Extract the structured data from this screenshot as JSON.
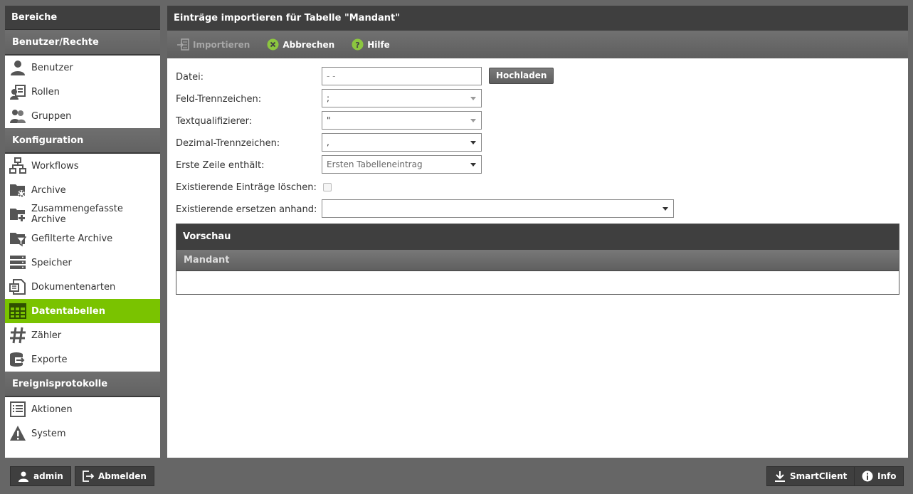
{
  "sidebar": {
    "title": "Bereiche",
    "sections": [
      {
        "label": "Benutzer/Rechte",
        "items": [
          {
            "label": "Benutzer",
            "icon": "user-icon"
          },
          {
            "label": "Rollen",
            "icon": "roles-icon"
          },
          {
            "label": "Gruppen",
            "icon": "group-icon"
          }
        ]
      },
      {
        "label": "Konfiguration",
        "items": [
          {
            "label": "Workflows",
            "icon": "workflow-icon"
          },
          {
            "label": "Archive",
            "icon": "archive-folder-icon"
          },
          {
            "label": "Zusammengefasste Archive",
            "icon": "combined-archive-icon"
          },
          {
            "label": "Gefilterte Archive",
            "icon": "filtered-archive-icon"
          },
          {
            "label": "Speicher",
            "icon": "storage-icon"
          },
          {
            "label": "Dokumentenarten",
            "icon": "document-types-icon"
          },
          {
            "label": "Datentabellen",
            "icon": "data-table-icon",
            "active": true
          },
          {
            "label": "Zähler",
            "icon": "hash-icon"
          },
          {
            "label": "Exporte",
            "icon": "export-icon"
          }
        ]
      },
      {
        "label": "Ereignisprotokolle",
        "items": [
          {
            "label": "Aktionen",
            "icon": "actions-log-icon"
          },
          {
            "label": "System",
            "icon": "warning-icon"
          }
        ]
      }
    ]
  },
  "main": {
    "title": "Einträge importieren für Tabelle \"Mandant\"",
    "toolbar": {
      "import_label": "Importieren",
      "cancel_label": "Abbrechen",
      "help_label": "Hilfe"
    },
    "form": {
      "file_label": "Datei:",
      "file_value": "- -",
      "upload_label": "Hochladen",
      "field_sep_label": "Feld-Trennzeichen:",
      "field_sep_value": ";",
      "text_qual_label": "Textqualifizierer:",
      "text_qual_value": "\"",
      "decimal_sep_label": "Dezimal-Trennzeichen:",
      "decimal_sep_value": ",",
      "first_row_label": "Erste Zeile enthält:",
      "first_row_value": "Ersten Tabelleneintrag",
      "delete_existing_label": "Existierende Einträge löschen:",
      "delete_existing_checked": false,
      "replace_by_label": "Existierende ersetzen anhand:",
      "replace_by_value": ""
    },
    "preview": {
      "title": "Vorschau",
      "column": "Mandant"
    }
  },
  "footer": {
    "user_label": "admin",
    "logout_label": "Abmelden",
    "smartclient_label": "SmartClient",
    "info_label": "Info"
  },
  "colors": {
    "accent": "#7ac300",
    "header_dark": "#3f3f3f",
    "background": "#666666"
  }
}
